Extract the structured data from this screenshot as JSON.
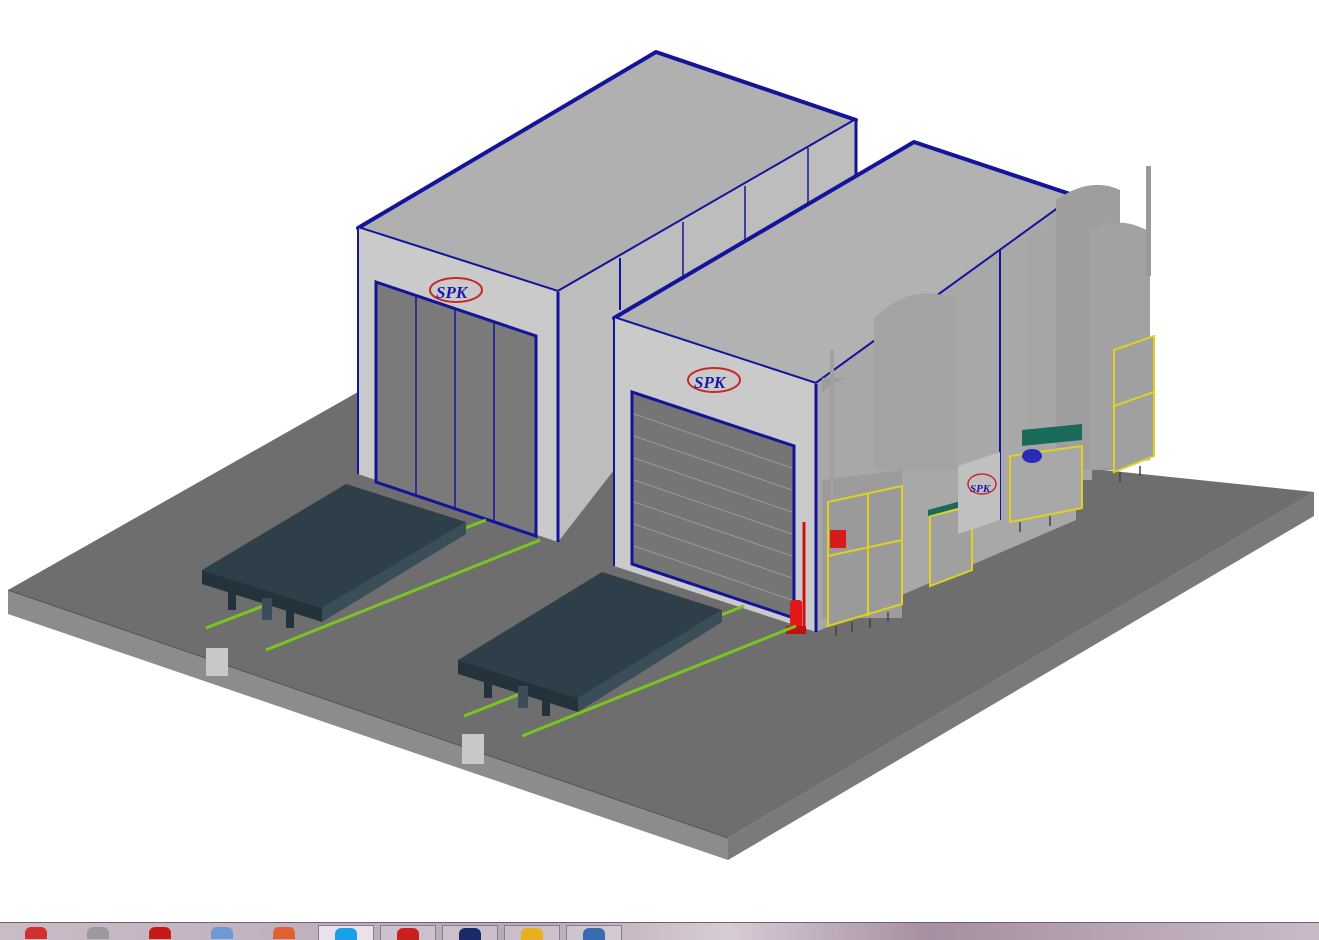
{
  "scene": {
    "booth_left": {
      "logo": "SPK"
    },
    "booth_right": {
      "logo": "SPK"
    },
    "mixing_room": {
      "logo": "SPK"
    }
  },
  "colors": {
    "wall_light": "#c8c8c8",
    "wall_mid": "#b4b4b4",
    "roof": "#b2b2b2",
    "trim_blue": "#14149a",
    "floor_top": "#6e6e6e",
    "floor_side": "#8a8a8a",
    "platform": "#2e3f49",
    "rail_green": "#7cc41e",
    "frame_yellow": "#e0d020",
    "unit_grey": "#9c9c9c",
    "extinguisher_red": "#e01818",
    "cyan": "#2ad0d0"
  },
  "taskbar": {
    "items": [
      {
        "name": "taskbar-app-1",
        "icon": "no-entry-icon",
        "color": "#d43030",
        "state": "normal"
      },
      {
        "name": "taskbar-app-2",
        "icon": "printer-icon",
        "color": "#9a9a9a",
        "state": "normal"
      },
      {
        "name": "taskbar-app-3",
        "icon": "browser-icon",
        "color": "#c81818",
        "state": "normal"
      },
      {
        "name": "taskbar-app-4",
        "icon": "folder-icon",
        "color": "#6a9ad8",
        "state": "normal"
      },
      {
        "name": "taskbar-app-5",
        "icon": "document-icon",
        "color": "#e06030",
        "state": "normal"
      },
      {
        "name": "taskbar-app-6",
        "icon": "chat-icon",
        "color": "#1aa0e8",
        "state": "active"
      },
      {
        "name": "taskbar-app-7",
        "icon": "pdf-icon",
        "color": "#cc2020",
        "state": "open"
      },
      {
        "name": "taskbar-app-8",
        "icon": "terminal-icon",
        "color": "#1a2a6a",
        "state": "open"
      },
      {
        "name": "taskbar-app-9",
        "icon": "lock-icon",
        "color": "#e8b020",
        "state": "open"
      },
      {
        "name": "taskbar-app-10",
        "icon": "monitor-icon",
        "color": "#3a6ab0",
        "state": "open"
      }
    ]
  }
}
